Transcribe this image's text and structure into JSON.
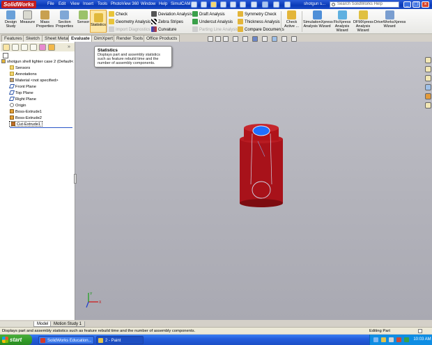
{
  "app": {
    "logo": "SolidWorks",
    "doc_title": "shotgun s..."
  },
  "menu": [
    "File",
    "Edit",
    "View",
    "Insert",
    "Tools",
    "PhotoView 360",
    "Window",
    "Help",
    "SimulCAM"
  ],
  "help_search": {
    "placeholder": "Search SolidWorks Help"
  },
  "window_buttons": {
    "minimize": "_",
    "restore": "❐",
    "close": "×"
  },
  "command_manager": {
    "big_tools": [
      {
        "label": "Design Study"
      },
      {
        "label": "Measure"
      },
      {
        "label": "Mass Properties"
      },
      {
        "label": "Section Properties"
      },
      {
        "label": "Sensor"
      },
      {
        "label": "Statistics"
      }
    ],
    "col1": [
      "Check",
      "Geometry Analysis",
      "Import Diagnostics"
    ],
    "col2": [
      "Deviation Analysis",
      "Zebra Stripes",
      "Curvature"
    ],
    "col3": [
      "Draft Analysis",
      "Undercut Analysis",
      "Parting Line Analysis"
    ],
    "col4": [
      "Symmetry Check",
      "Thickness Analysis",
      "Compare Documents"
    ],
    "right_tools": [
      {
        "label": "Check Active ..."
      },
      {
        "label": "SimulationXpress Analysis Wizard"
      },
      {
        "label": "FloXpress Analysis Wizard"
      },
      {
        "label": "DFMXpress Analysis Wizard"
      },
      {
        "label": "DriveWorksXpress Wizard"
      }
    ]
  },
  "tabs": [
    "Features",
    "Sketch",
    "Sheet Metal",
    "Evaluate",
    "DimXpert",
    "Render Tools",
    "Office Products"
  ],
  "active_tab": "Evaluate",
  "tooltip": {
    "title": "Statistics",
    "body": "Displays part and assembly statistics such as feature rebuild time and the number of assembly components."
  },
  "feature_tree": {
    "root": "shotgun shell lighter case 2  (Default<",
    "items": [
      {
        "label": "Sensors",
        "icon": "sensor-folder-icon"
      },
      {
        "label": "Annotations",
        "icon": "annotations-icon"
      },
      {
        "label": "Material <not specified>",
        "icon": "material-icon"
      },
      {
        "label": "Front Plane",
        "icon": "plane-icon"
      },
      {
        "label": "Top Plane",
        "icon": "plane-icon"
      },
      {
        "label": "Right Plane",
        "icon": "plane-icon"
      },
      {
        "label": "Origin",
        "icon": "origin-icon"
      },
      {
        "label": "Boss-Extrude1",
        "icon": "boss-extrude-icon"
      },
      {
        "label": "Boss-Extrude2",
        "icon": "boss-extrude-icon"
      },
      {
        "label": "Cut-Extrude1",
        "icon": "cut-extrude-icon"
      }
    ],
    "selected_item": "Cut-Extrude1"
  },
  "bottom_tabs": [
    "Model",
    "Motion Study 1"
  ],
  "status": {
    "message": "Displays part and assembly statistics such as feature rebuild time and the number of assembly components.",
    "mode": "Editing Part"
  },
  "triad": {
    "x": "X",
    "y": "Y"
  },
  "taskbar": {
    "start": "start",
    "tasks": [
      "SolidWorks Education...",
      "2 - Paint"
    ],
    "clock": "10:03 AM"
  },
  "colors": {
    "model_body": "#b01319",
    "model_body_dark": "#7d0c10",
    "selection_blue": "#1f6fff",
    "taskbar_blue": "#245edc",
    "start_green": "#309a26"
  }
}
